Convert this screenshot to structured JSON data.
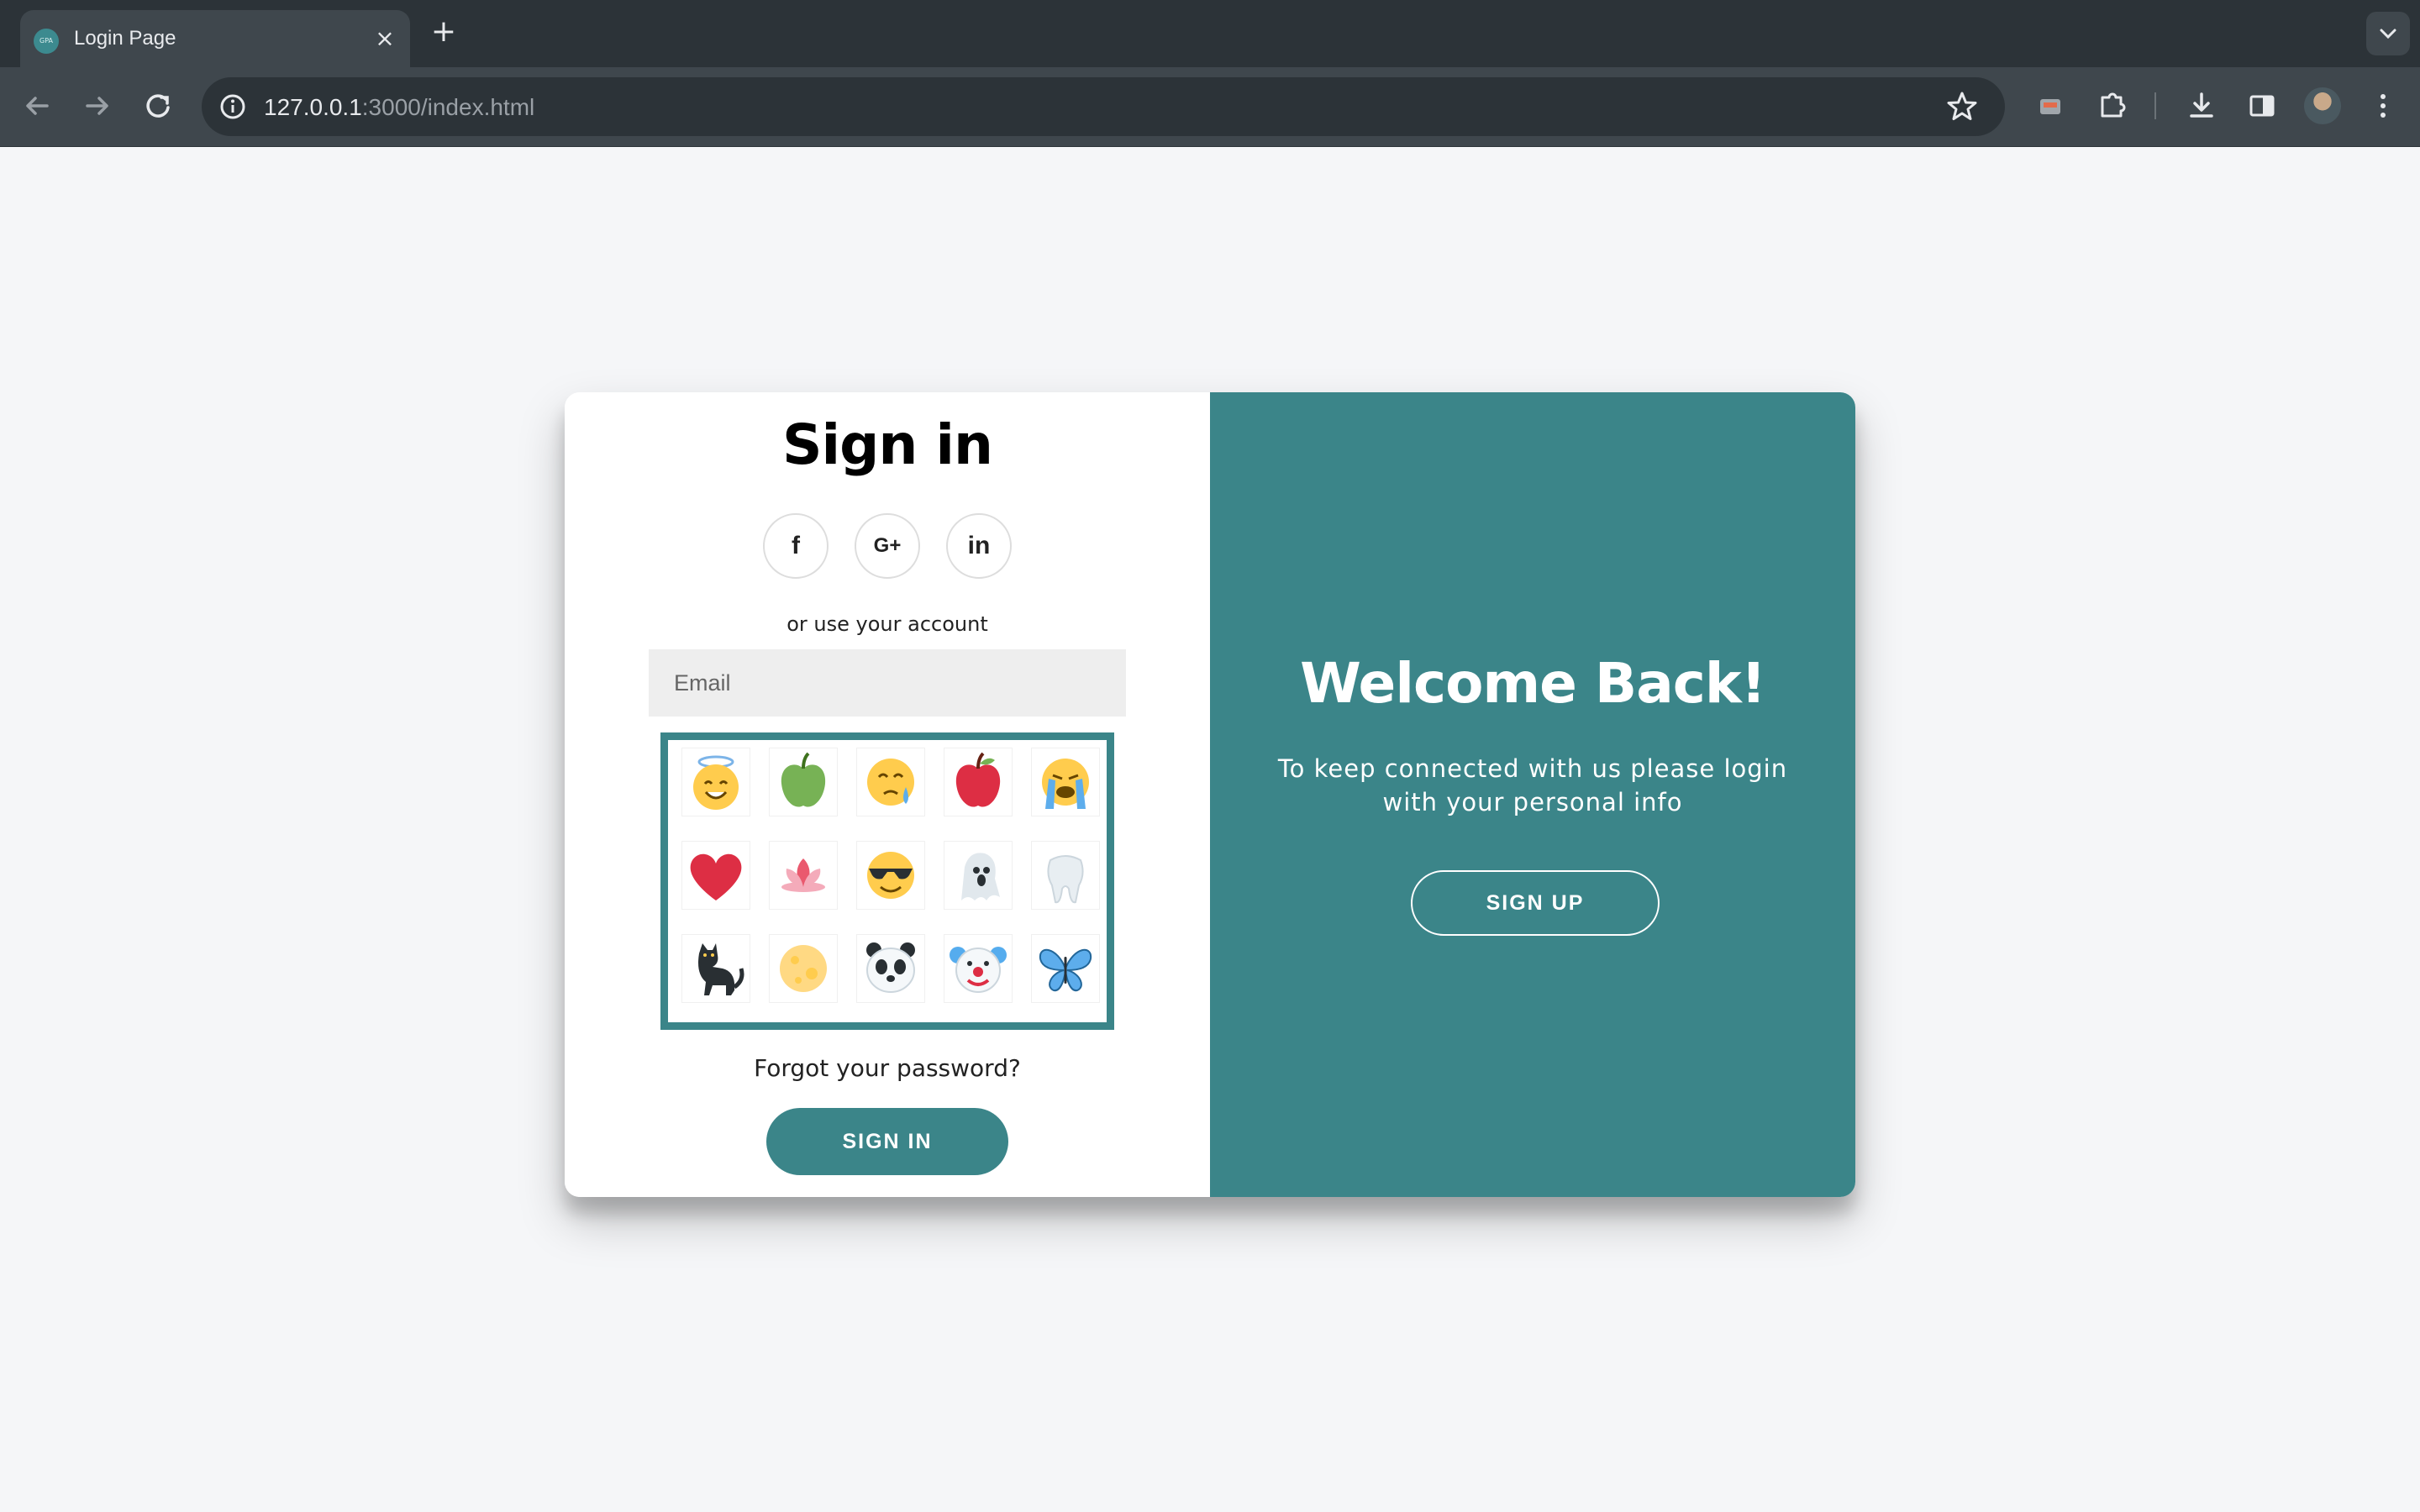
{
  "browser": {
    "tab_title": "Login Page",
    "favicon_text": "GPA",
    "url_host": "127.0.0.1",
    "url_rest": ":3000/index.html"
  },
  "signin": {
    "title": "Sign in",
    "social": [
      "f",
      "G+",
      "in"
    ],
    "or_text": "or use your account",
    "email_placeholder": "Email",
    "emojis": [
      "smiling-face-with-halo",
      "green-apple",
      "face-holding-back-tears",
      "red-apple",
      "loudly-crying-face",
      "red-heart",
      "lotus",
      "smiling-face-with-sunglasses",
      "ghost",
      "tooth",
      "black-cat",
      "full-moon",
      "panda",
      "clown-face",
      "butterfly"
    ],
    "forgot": "Forgot your password?",
    "button": "SIGN IN"
  },
  "welcome": {
    "title": "Welcome Back!",
    "subtitle": "To keep connected with us please login with your personal info",
    "button": "SIGN UP"
  },
  "colors": {
    "accent": "#3b8589",
    "page_bg": "#f5f6f8"
  }
}
